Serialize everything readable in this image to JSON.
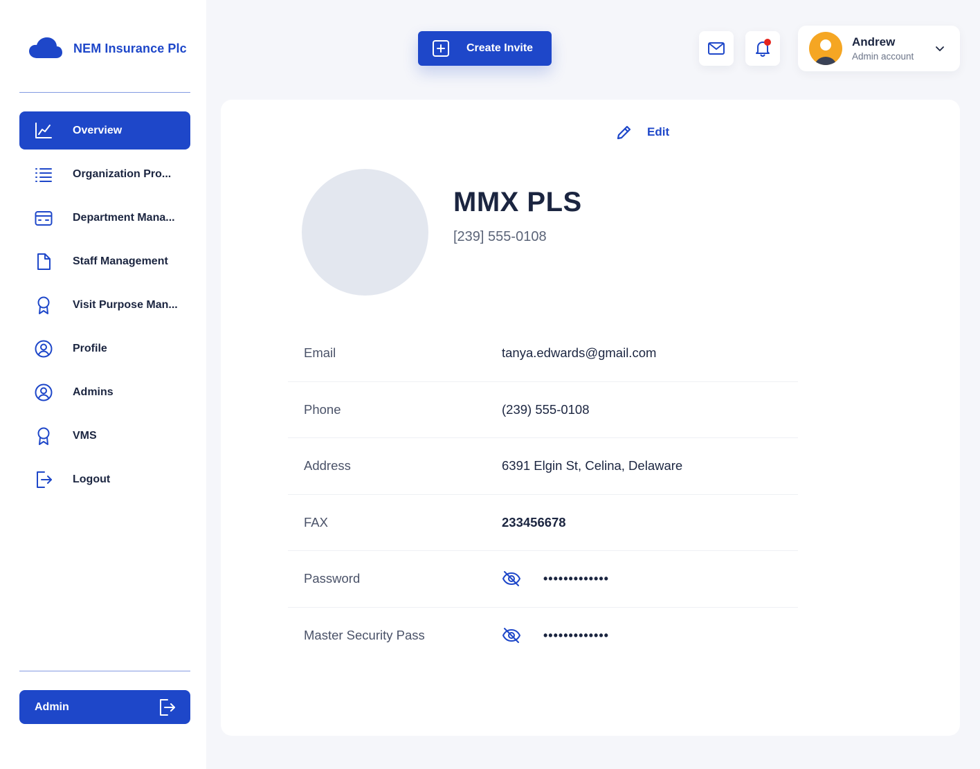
{
  "brand": {
    "name": "NEM Insurance Plc",
    "icon": "cloud-icon",
    "color": "#1e47c9"
  },
  "sidebar": {
    "items": [
      {
        "label": "Overview",
        "icon": "chart-line-icon",
        "active": true
      },
      {
        "label": "Organization Pro...",
        "icon": "list-icon",
        "active": false
      },
      {
        "label": "Department Mana...",
        "icon": "card-icon",
        "active": false
      },
      {
        "label": "Staff Management",
        "icon": "file-icon",
        "active": false
      },
      {
        "label": "Visit Purpose Man...",
        "icon": "award-icon",
        "active": false
      },
      {
        "label": "Profile",
        "icon": "user-circle-icon",
        "active": false
      },
      {
        "label": "Admins",
        "icon": "user-circle-icon",
        "active": false
      },
      {
        "label": "VMS",
        "icon": "award-icon",
        "active": false
      },
      {
        "label": "Logout",
        "icon": "logout-icon",
        "active": false
      }
    ],
    "admin_button": "Admin"
  },
  "header": {
    "create_invite": "Create Invite",
    "account": {
      "name": "Andrew",
      "role": "Admin account"
    }
  },
  "profile": {
    "edit_label": "Edit",
    "name": "MMX PLS",
    "phone": "[239] 555-0108",
    "details": {
      "email": {
        "label": "Email",
        "value": "tanya.edwards@gmail.com"
      },
      "phone": {
        "label": "Phone",
        "value": "(239) 555-0108"
      },
      "address": {
        "label": "Address",
        "value": "6391 Elgin St, Celina, Delaware"
      },
      "fax": {
        "label": "FAX",
        "value": "233456678"
      },
      "password": {
        "label": "Password",
        "value": "•••••••••••••"
      },
      "master_pass": {
        "label": "Master Security Pass",
        "value": "•••••••••••••"
      }
    }
  },
  "colors": {
    "primary": "#1e47c9",
    "notification_dot": "#e5231c",
    "avatar_bg": "#f5a623"
  }
}
